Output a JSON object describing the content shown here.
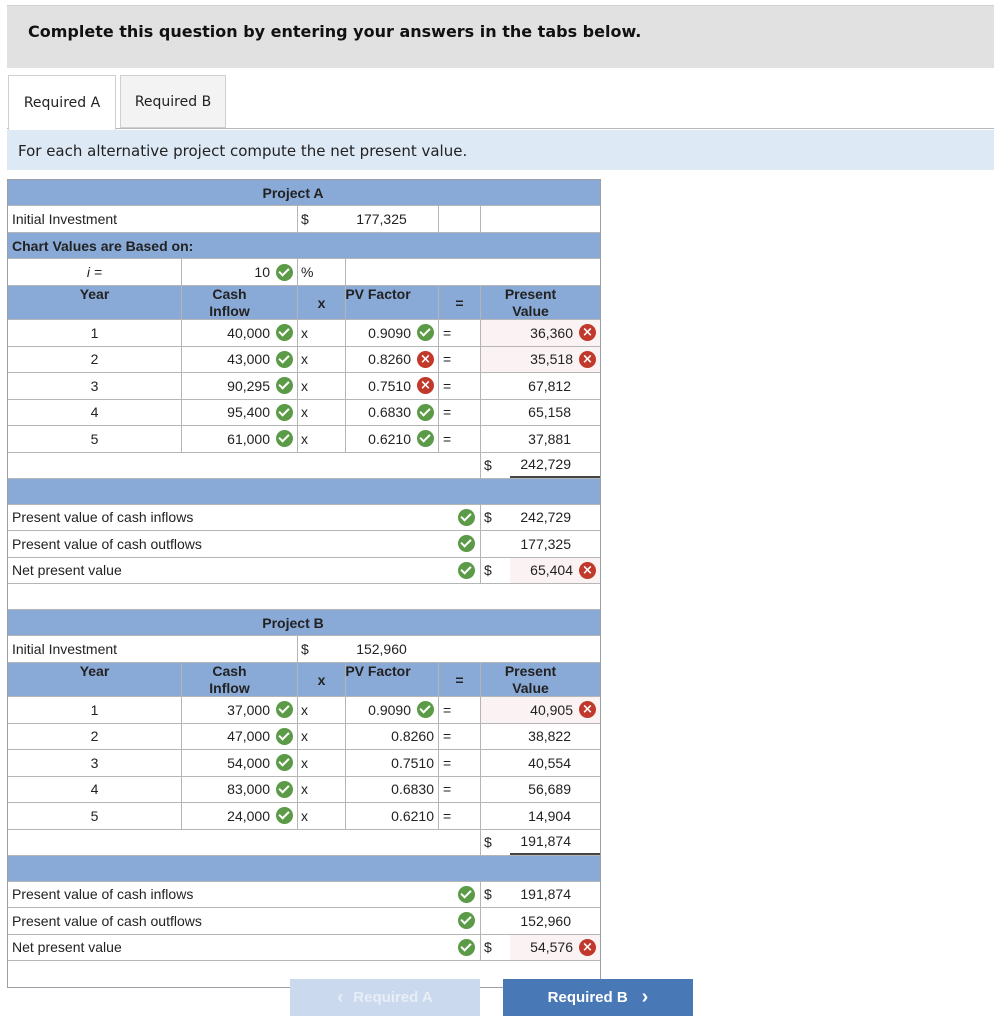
{
  "header": {
    "instruction": "Complete this question by entering your answers in the tabs below."
  },
  "tabs": [
    {
      "label": "Required A",
      "active": true
    },
    {
      "label": "Required B",
      "active": false
    }
  ],
  "prompt": "For each alternative project compute the net present value.",
  "symbols": {
    "dollar": "$",
    "times": "x",
    "equals": "=",
    "percent": "%",
    "i_eq": "i =",
    "cross": "×"
  },
  "project_a": {
    "title": "Project A",
    "initial_investment_label": "Initial Investment",
    "initial_investment": "177,325",
    "chart_values_label": "Chart Values are Based on:",
    "rate": "10",
    "col_year": "Year",
    "col_cash_inflow": "Cash Inflow",
    "col_pv_factor": "PV Factor",
    "col_present_value": "Present Value",
    "rows": [
      {
        "year": "1",
        "cash": "40,000",
        "cash_status": "correct",
        "factor": "0.9090",
        "factor_status": "correct",
        "pv": "36,360",
        "pv_status": "incorrect"
      },
      {
        "year": "2",
        "cash": "43,000",
        "cash_status": "correct",
        "factor": "0.8260",
        "factor_status": "incorrect",
        "pv": "35,518",
        "pv_status": "incorrect"
      },
      {
        "year": "3",
        "cash": "90,295",
        "cash_status": "correct",
        "factor": "0.7510",
        "factor_status": "incorrect",
        "pv": "67,812",
        "pv_status": "none"
      },
      {
        "year": "4",
        "cash": "95,400",
        "cash_status": "correct",
        "factor": "0.6830",
        "factor_status": "correct",
        "pv": "65,158",
        "pv_status": "none"
      },
      {
        "year": "5",
        "cash": "61,000",
        "cash_status": "correct",
        "factor": "0.6210",
        "factor_status": "correct",
        "pv": "37,881",
        "pv_status": "none"
      }
    ],
    "total_pv": "242,729",
    "pv_inflows_label": "Present value of cash inflows",
    "pv_inflows": "242,729",
    "pv_outflows_label": "Present value of cash outflows",
    "pv_outflows": "177,325",
    "npv_label": "Net present value",
    "npv": "65,404"
  },
  "project_b": {
    "title": "Project B",
    "initial_investment_label": "Initial Investment",
    "initial_investment": "152,960",
    "col_year": "Year",
    "col_cash_inflow": "Cash Inflow",
    "col_pv_factor": "PV Factor",
    "col_present_value": "Present Value",
    "rows": [
      {
        "year": "1",
        "cash": "37,000",
        "cash_status": "correct",
        "factor": "0.9090",
        "factor_status": "correct",
        "pv": "40,905",
        "pv_status": "incorrect"
      },
      {
        "year": "2",
        "cash": "47,000",
        "cash_status": "correct",
        "factor": "0.8260",
        "factor_status": "none",
        "pv": "38,822",
        "pv_status": "none"
      },
      {
        "year": "3",
        "cash": "54,000",
        "cash_status": "correct",
        "factor": "0.7510",
        "factor_status": "none",
        "pv": "40,554",
        "pv_status": "none"
      },
      {
        "year": "4",
        "cash": "83,000",
        "cash_status": "correct",
        "factor": "0.6830",
        "factor_status": "none",
        "pv": "56,689",
        "pv_status": "none"
      },
      {
        "year": "5",
        "cash": "24,000",
        "cash_status": "correct",
        "factor": "0.6210",
        "factor_status": "none",
        "pv": "14,904",
        "pv_status": "none"
      }
    ],
    "total_pv": "191,874",
    "pv_inflows_label": "Present value of cash inflows",
    "pv_inflows": "191,874",
    "pv_outflows_label": "Present value of cash outflows",
    "pv_outflows": "152,960",
    "npv_label": "Net present value",
    "npv": "54,576"
  },
  "nav": {
    "prev_label": "Required A",
    "next_label": "Required B",
    "prev_icon": "‹",
    "next_icon": "›"
  },
  "colors": {
    "header_blue": "#89a9d7",
    "correct": "#5b9a47",
    "incorrect": "#c0392b",
    "next_button": "#4978b6"
  }
}
